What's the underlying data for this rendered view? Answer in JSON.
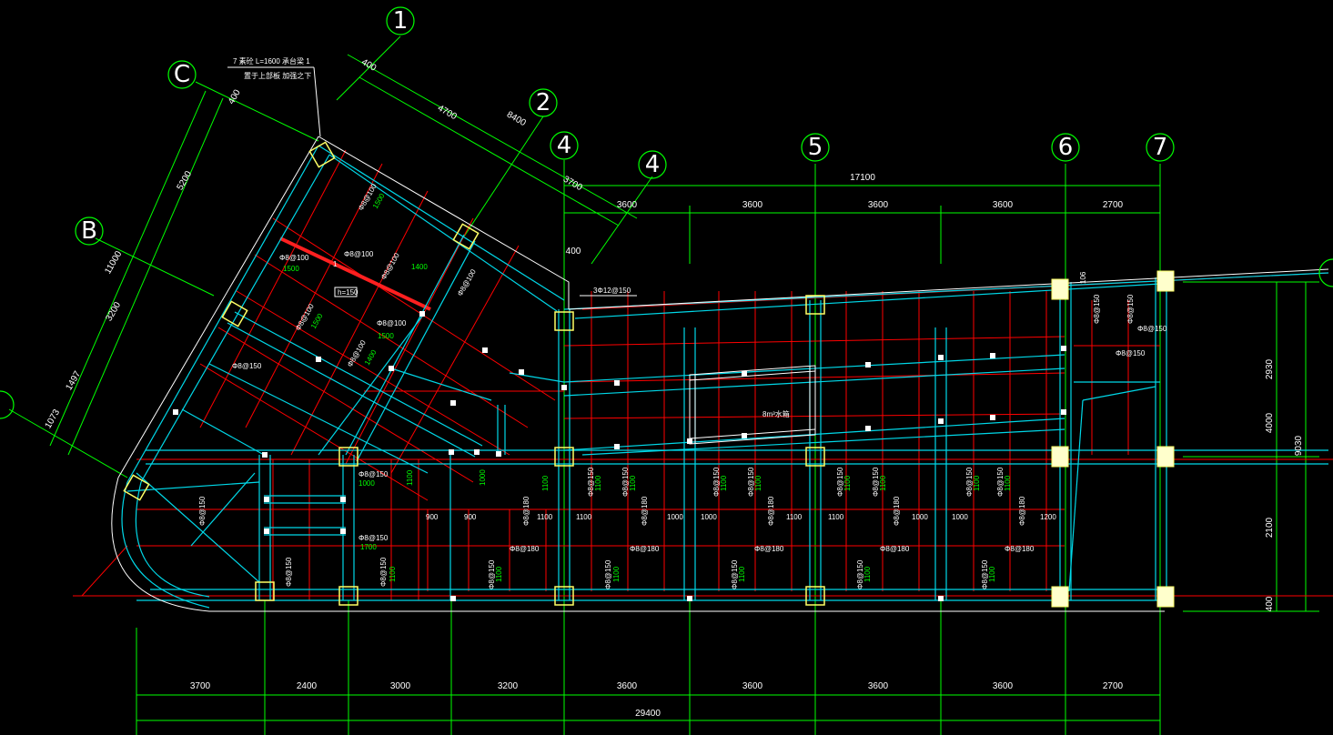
{
  "drawing": {
    "axis_labels": {
      "a1": "1",
      "a2": "2",
      "a4": "4",
      "a4b": "4",
      "a5": "5",
      "a6": "6",
      "a7": "7",
      "aB": "B",
      "aC": "C"
    },
    "top_dims": {
      "total": "17100",
      "d1": "3600",
      "d2": "3600",
      "d3": "3600",
      "d4": "3600",
      "d5": "2700",
      "small_3700": "3700",
      "small_400": "400"
    },
    "bottom_dims": {
      "total": "29400",
      "d1": "3700",
      "d2": "2400",
      "d3": "3000",
      "d4": "3200",
      "d5": "3600",
      "d6": "3600",
      "d7": "3600",
      "d8": "3600",
      "d9": "2700"
    },
    "right_dims": {
      "total": "9030",
      "d1": "2930",
      "d2": "2100",
      "d3": "4000",
      "d4": "400"
    },
    "diag_dims": {
      "d400": "400",
      "d4700": "4700",
      "d8400": "8400"
    },
    "left_dims": {
      "d400": "400",
      "d5200": "5200",
      "d11000": "11000",
      "d3200": "3200",
      "d1497": "1497",
      "d1073": "1073"
    },
    "notes": {
      "top_note1": "7 素砼 L=1600   承台梁 1",
      "top_note2": "置于上部板 加强之下",
      "box": "h=150",
      "section": "1",
      "tank": "8m³水箱",
      "rebar_3d12": "3Φ12@150",
      "right_106": "106"
    },
    "rebar": {
      "r100": "Φ8@100",
      "r150": "Φ8@150",
      "r180": "Φ8@180",
      "r150b": "Φ10@150"
    },
    "green": {
      "g1100": "1100",
      "g1000": "1000",
      "g1500": "1500",
      "g1400": "1400",
      "g1700": "1700"
    },
    "span_dims": {
      "s900": "900",
      "s1100": "1100",
      "s1000": "1000",
      "s1200": "1200"
    }
  }
}
